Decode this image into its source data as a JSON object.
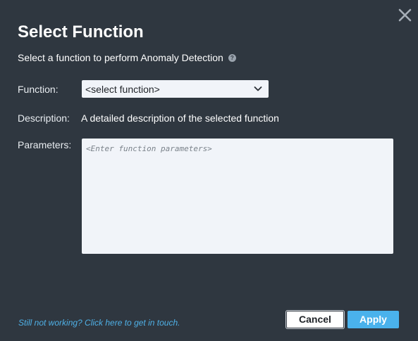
{
  "dialog": {
    "title": "Select Function",
    "subtitle": "Select a function to perform Anomaly Detection",
    "help_icon_glyph": "?",
    "close_icon": "close-icon"
  },
  "form": {
    "function_label": "Function:",
    "function_selected": "<select function>",
    "description_label": "Description:",
    "description_value": "A detailed description of the selected function",
    "parameters_label": "Parameters:",
    "parameters_value": "",
    "parameters_placeholder": "<Enter function parameters>"
  },
  "footer": {
    "help_link": "Still not working? Click here to get in touch.",
    "cancel_label": "Cancel",
    "apply_label": "Apply"
  },
  "colors": {
    "background": "#2f3740",
    "accent": "#4ab2ec",
    "link": "#4fb0e6",
    "input_bg": "#f1f4f9"
  }
}
